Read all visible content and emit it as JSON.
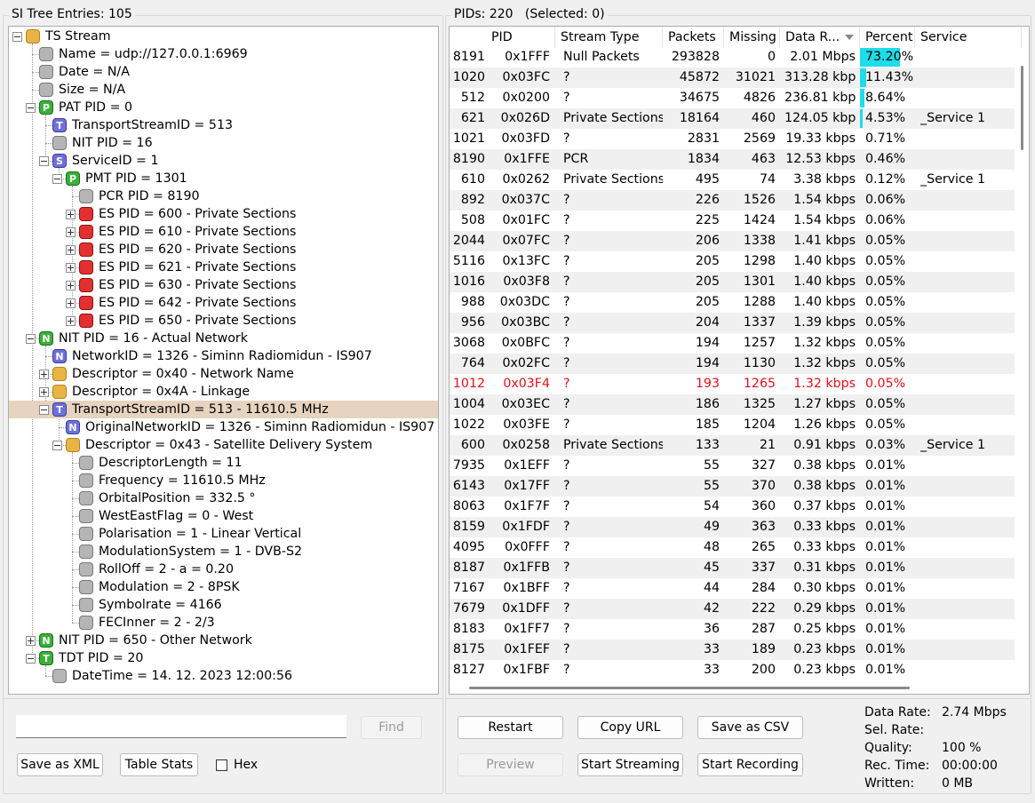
{
  "left_panel": {
    "title": "SI Tree Entries: 105",
    "tree": [
      {
        "label": "TS Stream",
        "icon": "folder"
      },
      {
        "label": "Name = udp://127.0.0.1:6969",
        "icon": "gray"
      },
      {
        "label": "Date = N/A",
        "icon": "gray"
      },
      {
        "label": "Size = N/A",
        "icon": "gray"
      },
      {
        "label": "PAT PID = 0",
        "icon": "green",
        "letter": "P"
      },
      {
        "label": "TransportStreamID = 513",
        "icon": "blue",
        "letter": "T"
      },
      {
        "label": "NIT PID = 16",
        "icon": "gray"
      },
      {
        "label": "ServiceID = 1",
        "icon": "blue",
        "letter": "S"
      },
      {
        "label": "PMT PID = 1301",
        "icon": "green",
        "letter": "P"
      },
      {
        "label": "PCR PID = 8190",
        "icon": "gray"
      },
      {
        "label": "ES PID = 600 - Private Sections",
        "icon": "red"
      },
      {
        "label": "ES PID = 610 - Private Sections",
        "icon": "red"
      },
      {
        "label": "ES PID = 620 - Private Sections",
        "icon": "red"
      },
      {
        "label": "ES PID = 621 - Private Sections",
        "icon": "red"
      },
      {
        "label": "ES PID = 630 - Private Sections",
        "icon": "red"
      },
      {
        "label": "ES PID = 642 - Private Sections",
        "icon": "red"
      },
      {
        "label": "ES PID = 650 - Private Sections",
        "icon": "red"
      },
      {
        "label": "NIT PID = 16 - Actual Network",
        "icon": "green",
        "letter": "N"
      },
      {
        "label": "NetworkID = 1326 - Siminn Radiomidun - IS907",
        "icon": "blue",
        "letter": "N"
      },
      {
        "label": "Descriptor = 0x40 - Network Name",
        "icon": "folder"
      },
      {
        "label": "Descriptor = 0x4A - Linkage",
        "icon": "folder"
      },
      {
        "label": "TransportStreamID = 513 - 11610.5 MHz",
        "icon": "blue",
        "letter": "T"
      },
      {
        "label": "OriginalNetworkID = 1326 - Siminn Radiomidun - IS907",
        "icon": "blue",
        "letter": "N"
      },
      {
        "label": "Descriptor = 0x43 - Satellite Delivery System",
        "icon": "folder"
      },
      {
        "label": "DescriptorLength = 11",
        "icon": "gray"
      },
      {
        "label": "Frequency = 11610.5 MHz",
        "icon": "gray"
      },
      {
        "label": "OrbitalPosition = 332.5 °",
        "icon": "gray"
      },
      {
        "label": "WestEastFlag = 0 - West",
        "icon": "gray"
      },
      {
        "label": "Polarisation = 1 - Linear Vertical",
        "icon": "gray"
      },
      {
        "label": "ModulationSystem = 1 - DVB-S2",
        "icon": "gray"
      },
      {
        "label": "RollOff = 2 - a = 0.20",
        "icon": "gray"
      },
      {
        "label": "Modulation = 2 - 8PSK",
        "icon": "gray"
      },
      {
        "label": "Symbolrate = 4166",
        "icon": "gray"
      },
      {
        "label": "FECInner = 2 - 2/3",
        "icon": "gray"
      },
      {
        "label": "NIT PID = 650 - Other Network",
        "icon": "green",
        "letter": "N"
      },
      {
        "label": "TDT PID = 20",
        "icon": "green",
        "letter": "T"
      },
      {
        "label": "DateTime = 14. 12. 2023 12:00:56",
        "icon": "gray"
      }
    ],
    "search": {
      "value": "",
      "find_label": "Find"
    },
    "save_xml_label": "Save as XML",
    "table_stats_label": "Table Stats",
    "hex_label": "Hex"
  },
  "right_panel": {
    "title": "PIDs: 220   (Selected: 0)",
    "columns": [
      "PID",
      "Stream Type",
      "Packets",
      "Missing",
      "Data R...",
      "Percent",
      "Service"
    ],
    "rows": [
      {
        "pid": "8191",
        "hex": "0x1FFF",
        "type": "Null Packets",
        "packets": "293828",
        "missing": "0",
        "rate": "2.01 Mbps",
        "percent": "73.20%",
        "pct": 73.2,
        "service": ""
      },
      {
        "pid": "1020",
        "hex": "0x03FC",
        "type": "?",
        "packets": "45872",
        "missing": "31021",
        "rate": "313.28 kbps",
        "percent": "11.43%",
        "pct": 11.43,
        "service": ""
      },
      {
        "pid": "512",
        "hex": "0x0200",
        "type": "?",
        "packets": "34675",
        "missing": "4826",
        "rate": "236.81 kbps",
        "percent": "8.64%",
        "pct": 8.64,
        "service": ""
      },
      {
        "pid": "621",
        "hex": "0x026D",
        "type": "Private Sections",
        "packets": "18164",
        "missing": "460",
        "rate": "124.05 kbps",
        "percent": "4.53%",
        "pct": 4.53,
        "service": "_Service 1"
      },
      {
        "pid": "1021",
        "hex": "0x03FD",
        "type": "?",
        "packets": "2831",
        "missing": "2569",
        "rate": "19.33 kbps",
        "percent": "0.71%",
        "pct": 0.71,
        "service": ""
      },
      {
        "pid": "8190",
        "hex": "0x1FFE",
        "type": "PCR",
        "packets": "1834",
        "missing": "463",
        "rate": "12.53 kbps",
        "percent": "0.46%",
        "pct": 0.46,
        "service": ""
      },
      {
        "pid": "610",
        "hex": "0x0262",
        "type": "Private Sections",
        "packets": "495",
        "missing": "74",
        "rate": "3.38 kbps",
        "percent": "0.12%",
        "pct": 0.12,
        "service": "_Service 1"
      },
      {
        "pid": "892",
        "hex": "0x037C",
        "type": "?",
        "packets": "226",
        "missing": "1526",
        "rate": "1.54 kbps",
        "percent": "0.06%",
        "pct": 0.06,
        "service": ""
      },
      {
        "pid": "508",
        "hex": "0x01FC",
        "type": "?",
        "packets": "225",
        "missing": "1424",
        "rate": "1.54 kbps",
        "percent": "0.06%",
        "pct": 0.06,
        "service": ""
      },
      {
        "pid": "2044",
        "hex": "0x07FC",
        "type": "?",
        "packets": "206",
        "missing": "1338",
        "rate": "1.41 kbps",
        "percent": "0.05%",
        "pct": 0.05,
        "service": ""
      },
      {
        "pid": "5116",
        "hex": "0x13FC",
        "type": "?",
        "packets": "205",
        "missing": "1298",
        "rate": "1.40 kbps",
        "percent": "0.05%",
        "pct": 0.05,
        "service": ""
      },
      {
        "pid": "1016",
        "hex": "0x03F8",
        "type": "?",
        "packets": "205",
        "missing": "1301",
        "rate": "1.40 kbps",
        "percent": "0.05%",
        "pct": 0.05,
        "service": ""
      },
      {
        "pid": "988",
        "hex": "0x03DC",
        "type": "?",
        "packets": "205",
        "missing": "1288",
        "rate": "1.40 kbps",
        "percent": "0.05%",
        "pct": 0.05,
        "service": ""
      },
      {
        "pid": "956",
        "hex": "0x03BC",
        "type": "?",
        "packets": "204",
        "missing": "1337",
        "rate": "1.39 kbps",
        "percent": "0.05%",
        "pct": 0.05,
        "service": ""
      },
      {
        "pid": "3068",
        "hex": "0x0BFC",
        "type": "?",
        "packets": "194",
        "missing": "1257",
        "rate": "1.32 kbps",
        "percent": "0.05%",
        "pct": 0.05,
        "service": ""
      },
      {
        "pid": "764",
        "hex": "0x02FC",
        "type": "?",
        "packets": "194",
        "missing": "1130",
        "rate": "1.32 kbps",
        "percent": "0.05%",
        "pct": 0.05,
        "service": ""
      },
      {
        "pid": "1012",
        "hex": "0x03F4",
        "type": "?",
        "packets": "193",
        "missing": "1265",
        "rate": "1.32 kbps",
        "percent": "0.05%",
        "pct": 0.05,
        "service": "",
        "red": true
      },
      {
        "pid": "1004",
        "hex": "0x03EC",
        "type": "?",
        "packets": "186",
        "missing": "1325",
        "rate": "1.27 kbps",
        "percent": "0.05%",
        "pct": 0.05,
        "service": ""
      },
      {
        "pid": "1022",
        "hex": "0x03FE",
        "type": "?",
        "packets": "185",
        "missing": "1204",
        "rate": "1.26 kbps",
        "percent": "0.05%",
        "pct": 0.05,
        "service": ""
      },
      {
        "pid": "600",
        "hex": "0x0258",
        "type": "Private Sections",
        "packets": "133",
        "missing": "21",
        "rate": "0.91 kbps",
        "percent": "0.03%",
        "pct": 0.03,
        "service": "_Service 1"
      },
      {
        "pid": "7935",
        "hex": "0x1EFF",
        "type": "?",
        "packets": "55",
        "missing": "327",
        "rate": "0.38 kbps",
        "percent": "0.01%",
        "pct": 0.01,
        "service": ""
      },
      {
        "pid": "6143",
        "hex": "0x17FF",
        "type": "?",
        "packets": "55",
        "missing": "370",
        "rate": "0.38 kbps",
        "percent": "0.01%",
        "pct": 0.01,
        "service": ""
      },
      {
        "pid": "8063",
        "hex": "0x1F7F",
        "type": "?",
        "packets": "54",
        "missing": "360",
        "rate": "0.37 kbps",
        "percent": "0.01%",
        "pct": 0.01,
        "service": ""
      },
      {
        "pid": "8159",
        "hex": "0x1FDF",
        "type": "?",
        "packets": "49",
        "missing": "363",
        "rate": "0.33 kbps",
        "percent": "0.01%",
        "pct": 0.01,
        "service": ""
      },
      {
        "pid": "4095",
        "hex": "0x0FFF",
        "type": "?",
        "packets": "48",
        "missing": "265",
        "rate": "0.33 kbps",
        "percent": "0.01%",
        "pct": 0.01,
        "service": ""
      },
      {
        "pid": "8187",
        "hex": "0x1FFB",
        "type": "?",
        "packets": "45",
        "missing": "337",
        "rate": "0.31 kbps",
        "percent": "0.01%",
        "pct": 0.01,
        "service": ""
      },
      {
        "pid": "7167",
        "hex": "0x1BFF",
        "type": "?",
        "packets": "44",
        "missing": "284",
        "rate": "0.30 kbps",
        "percent": "0.01%",
        "pct": 0.01,
        "service": ""
      },
      {
        "pid": "7679",
        "hex": "0x1DFF",
        "type": "?",
        "packets": "42",
        "missing": "222",
        "rate": "0.29 kbps",
        "percent": "0.01%",
        "pct": 0.01,
        "service": ""
      },
      {
        "pid": "8183",
        "hex": "0x1FF7",
        "type": "?",
        "packets": "36",
        "missing": "287",
        "rate": "0.25 kbps",
        "percent": "0.01%",
        "pct": 0.01,
        "service": ""
      },
      {
        "pid": "8175",
        "hex": "0x1FEF",
        "type": "?",
        "packets": "33",
        "missing": "189",
        "rate": "0.23 kbps",
        "percent": "0.01%",
        "pct": 0.01,
        "service": ""
      },
      {
        "pid": "8127",
        "hex": "0x1FBF",
        "type": "?",
        "packets": "33",
        "missing": "200",
        "rate": "0.23 kbps",
        "percent": "0.01%",
        "pct": 0.01,
        "service": ""
      }
    ],
    "buttons": {
      "restart": "Restart",
      "copy_url": "Copy URL",
      "save_csv": "Save as CSV",
      "preview": "Preview",
      "start_streaming": "Start Streaming",
      "start_recording": "Start Recording"
    },
    "stats": [
      {
        "label": "Data Rate:",
        "value": "2.74 Mbps"
      },
      {
        "label": "Sel. Rate:",
        "value": ""
      },
      {
        "label": "Quality:",
        "value": "100 %"
      },
      {
        "label": "Rec. Time:",
        "value": "00:00:00"
      },
      {
        "label": "Written:",
        "value": "0 MB"
      }
    ]
  },
  "colors": {
    "selection": "#e6d4c0",
    "percent_bar": "#1ddde8",
    "error_row": "#e0101c"
  }
}
